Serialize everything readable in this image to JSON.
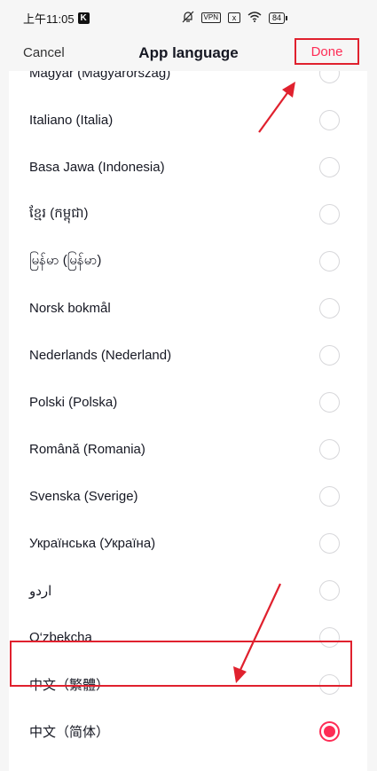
{
  "status_bar": {
    "time": "上午11:05",
    "k_badge": "K",
    "vpn": "VPN",
    "sim": "x",
    "battery": "84"
  },
  "header": {
    "cancel_label": "Cancel",
    "title": "App language",
    "done_label": "Done"
  },
  "languages": [
    {
      "label": "Magyar (Magyarország)",
      "selected": false
    },
    {
      "label": "Italiano (Italia)",
      "selected": false
    },
    {
      "label": "Basa Jawa (Indonesia)",
      "selected": false
    },
    {
      "label": "ខ្មែរ (កម្ពុជា)",
      "selected": false
    },
    {
      "label": "မြန်မာ (မြန်မာ)",
      "selected": false
    },
    {
      "label": "Norsk bokmål",
      "selected": false
    },
    {
      "label": "Nederlands (Nederland)",
      "selected": false
    },
    {
      "label": "Polski (Polska)",
      "selected": false
    },
    {
      "label": "Română (Romania)",
      "selected": false
    },
    {
      "label": "Svenska (Sverige)",
      "selected": false
    },
    {
      "label": "Українська (Україна)",
      "selected": false
    },
    {
      "label": "اردو",
      "selected": false
    },
    {
      "label": "O‘zbekcha",
      "selected": false
    },
    {
      "label": "中文（繁體）",
      "selected": false
    },
    {
      "label": "中文（简体）",
      "selected": true
    }
  ],
  "colors": {
    "accent": "#fe2c55",
    "annotation": "#e0212e"
  }
}
